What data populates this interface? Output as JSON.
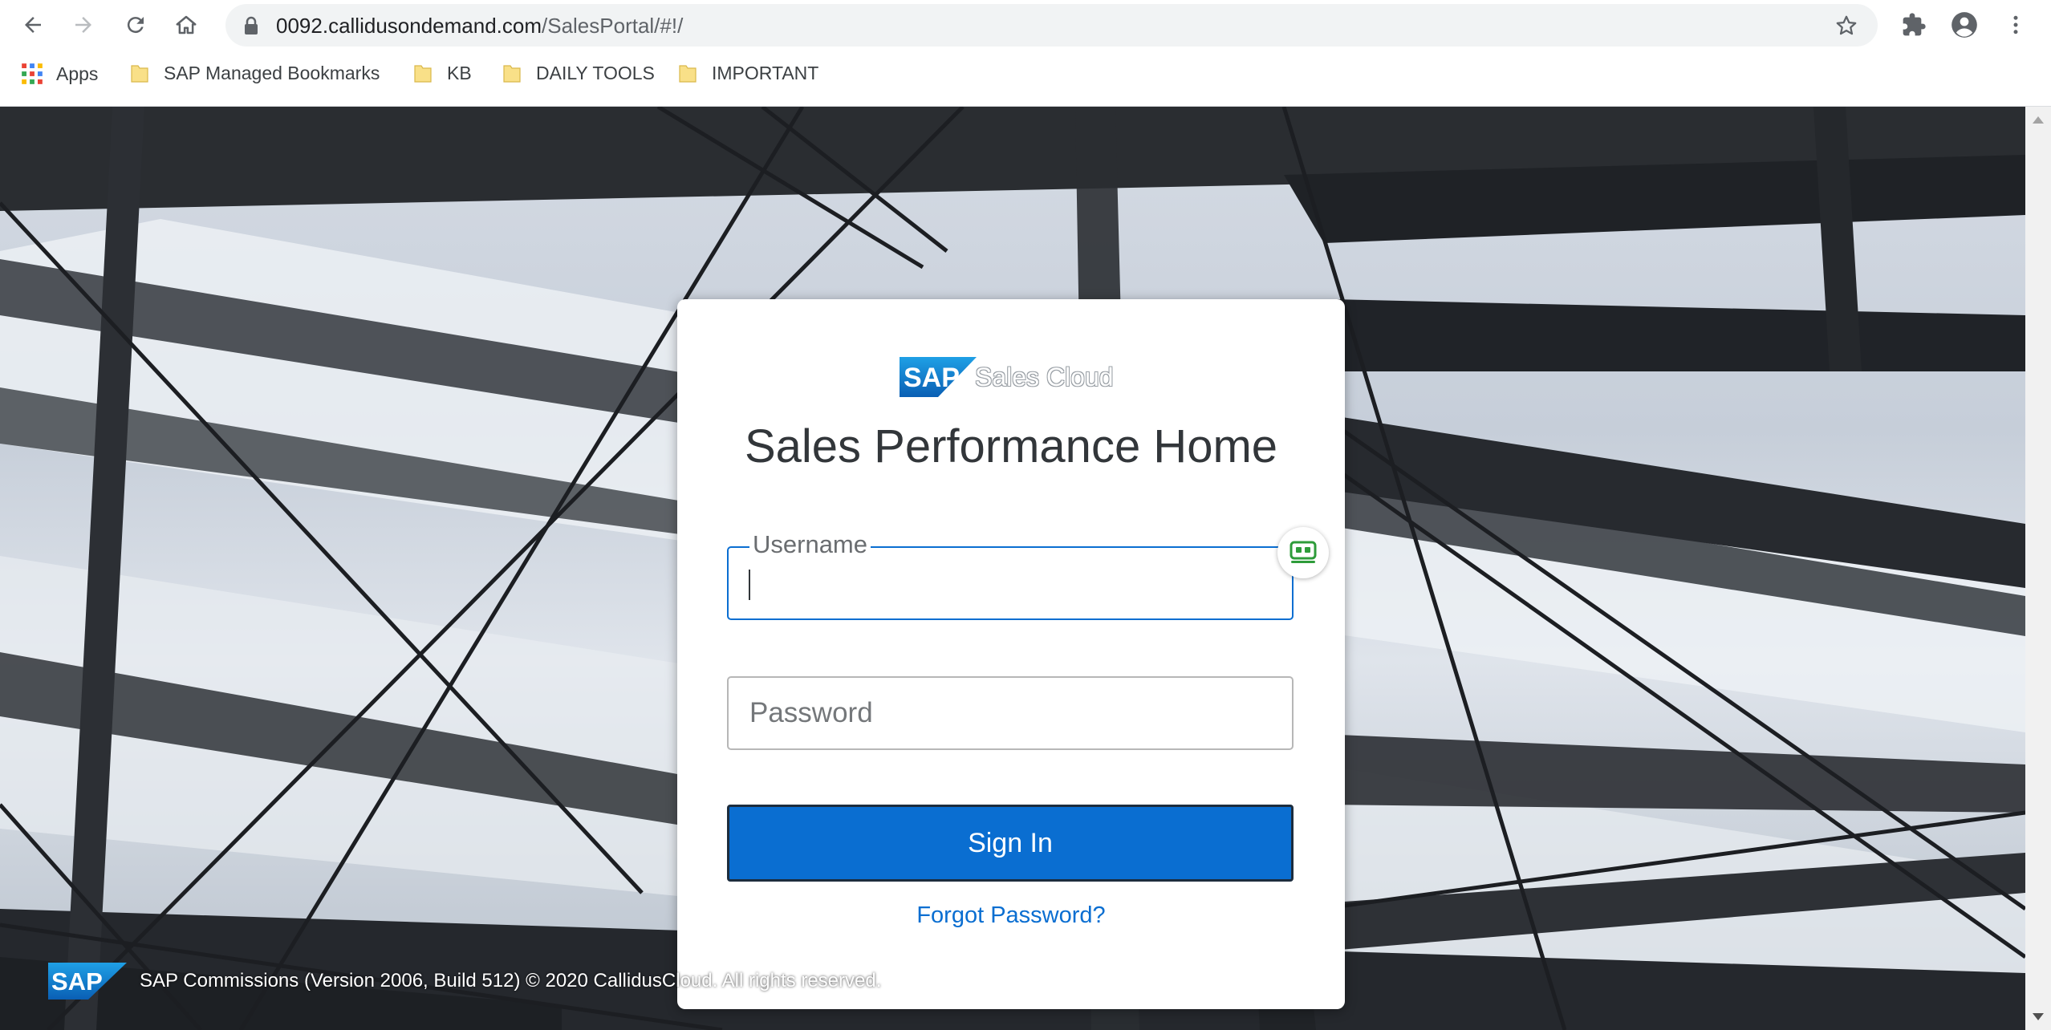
{
  "browser": {
    "url_host": "0092.callidusondemand.com",
    "url_path": "/SalesPortal/#!/",
    "bookmarks": [
      {
        "label": "Apps",
        "icon": "apps-grid-icon"
      },
      {
        "label": "SAP Managed Bookmarks",
        "icon": "folder-icon"
      },
      {
        "label": "KB",
        "icon": "folder-icon"
      },
      {
        "label": "DAILY TOOLS",
        "icon": "folder-icon"
      },
      {
        "label": "IMPORTANT",
        "icon": "folder-icon"
      }
    ]
  },
  "login": {
    "logo_text": "SAP",
    "product": "Sales Cloud",
    "title": "Sales Performance Home",
    "username_label": "Username",
    "username_value": "",
    "password_placeholder": "Password",
    "sign_in_label": "Sign In",
    "forgot_label": "Forgot Password?"
  },
  "footer": {
    "logo_text": "SAP",
    "copyright": "SAP Commissions (Version 2006, Build 512) © 2020 CallidusCloud. All rights reserved."
  },
  "colors": {
    "accent": "#0a6ed1",
    "sap_blue": "#1a73c8",
    "field_border": "#b7b7b7"
  }
}
